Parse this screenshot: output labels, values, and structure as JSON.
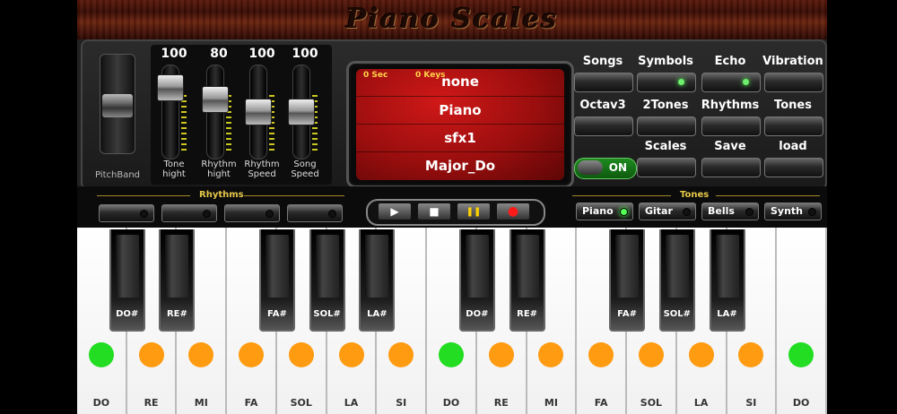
{
  "app": {
    "title": "Piano Scales"
  },
  "pitchband": {
    "label": "PitchBand"
  },
  "faders": [
    {
      "value": "100",
      "label_line1": "Tone",
      "label_line2": "hight",
      "level": 0.85
    },
    {
      "value": "80",
      "label_line1": "Rhythm",
      "label_line2": "hight",
      "level": 0.68
    },
    {
      "value": "100",
      "label_line1": "Rhythm",
      "label_line2": "Speed",
      "level": 0.5
    },
    {
      "value": "100",
      "label_line1": "Song",
      "label_line2": "Speed",
      "level": 0.5
    }
  ],
  "display": {
    "time": "0 Sec",
    "keys": "0 Keys",
    "rows": [
      "none",
      "Piano",
      "sfx1",
      "Major_Do"
    ]
  },
  "right_buttons": [
    {
      "label": "Songs",
      "led": false
    },
    {
      "label": "Symbols",
      "led": true
    },
    {
      "label": "Echo",
      "led": true
    },
    {
      "label": "Vibration",
      "led": false
    },
    {
      "label": "Octav3",
      "led": false
    },
    {
      "label": "2Tones",
      "led": false
    },
    {
      "label": "Rhythms",
      "led": false
    },
    {
      "label": "Tones",
      "led": false
    },
    {
      "label": "Scales",
      "led": false
    },
    {
      "label": "Save",
      "led": false
    },
    {
      "label": "load",
      "led": false
    }
  ],
  "toggle": {
    "label": "ON",
    "state": "on"
  },
  "rhythms": {
    "title": "Rhythms",
    "count": 4
  },
  "transport": {
    "play_icon": "▶",
    "stop_icon": "■",
    "pause_icon": "❚❚",
    "record_icon": "●"
  },
  "tones": {
    "title": "Tones",
    "items": [
      {
        "label": "Piano",
        "active": true
      },
      {
        "label": "Gitar",
        "active": false
      },
      {
        "label": "Bells",
        "active": false
      },
      {
        "label": "Synth",
        "active": false
      }
    ]
  },
  "white_keys": [
    {
      "name": "DO",
      "ball": "green"
    },
    {
      "name": "RE",
      "ball": "orange"
    },
    {
      "name": "MI",
      "ball": "orange"
    },
    {
      "name": "FA",
      "ball": "orange"
    },
    {
      "name": "SOL",
      "ball": "orange"
    },
    {
      "name": "LA",
      "ball": "orange"
    },
    {
      "name": "SI",
      "ball": "orange"
    },
    {
      "name": "DO",
      "ball": "green"
    },
    {
      "name": "RE",
      "ball": "orange"
    },
    {
      "name": "MI",
      "ball": "orange"
    },
    {
      "name": "FA",
      "ball": "orange"
    },
    {
      "name": "SOL",
      "ball": "orange"
    },
    {
      "name": "LA",
      "ball": "orange"
    },
    {
      "name": "SI",
      "ball": "orange"
    },
    {
      "name": "DO",
      "ball": "green"
    }
  ],
  "black_keys": [
    "DO#",
    "RE#",
    "FA#",
    "SOL#",
    "LA#",
    "DO#",
    "RE#",
    "FA#",
    "SOL#",
    "LA#"
  ],
  "colors": {
    "green_ball": "#22dd22",
    "orange_ball": "#ff9b10",
    "accent_gold": "#e7c94a"
  }
}
